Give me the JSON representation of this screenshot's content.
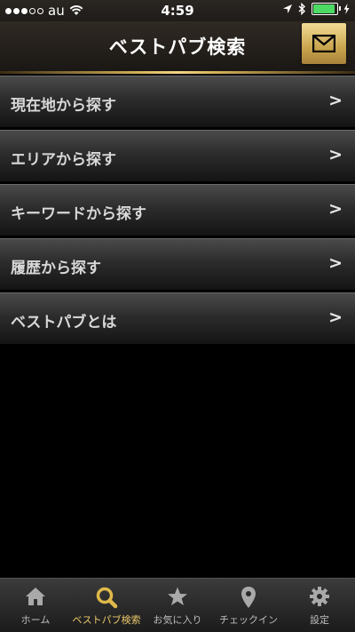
{
  "status_bar": {
    "carrier": "au",
    "time": "4:59"
  },
  "header": {
    "title": "ベストパブ検索"
  },
  "menu": {
    "items": [
      {
        "label": "現在地から探す",
        "arrow": ">"
      },
      {
        "label": "エリアから探す",
        "arrow": ">"
      },
      {
        "label": "キーワードから探す",
        "arrow": ">"
      },
      {
        "label": "履歴から探す",
        "arrow": ">"
      },
      {
        "label": "ベストパブとは",
        "arrow": ">"
      }
    ]
  },
  "tabbar": {
    "tabs": [
      {
        "label": "ホーム",
        "icon": "home-icon"
      },
      {
        "label": "ベストパブ検索",
        "icon": "search-icon",
        "active": true
      },
      {
        "label": "お気に入り",
        "icon": "star-icon"
      },
      {
        "label": "チェックイン",
        "icon": "map-pin-icon"
      },
      {
        "label": "設定",
        "icon": "gear-icon"
      }
    ]
  },
  "colors": {
    "accent_gold": "#e8c66a",
    "battery_green": "#4cd964"
  }
}
